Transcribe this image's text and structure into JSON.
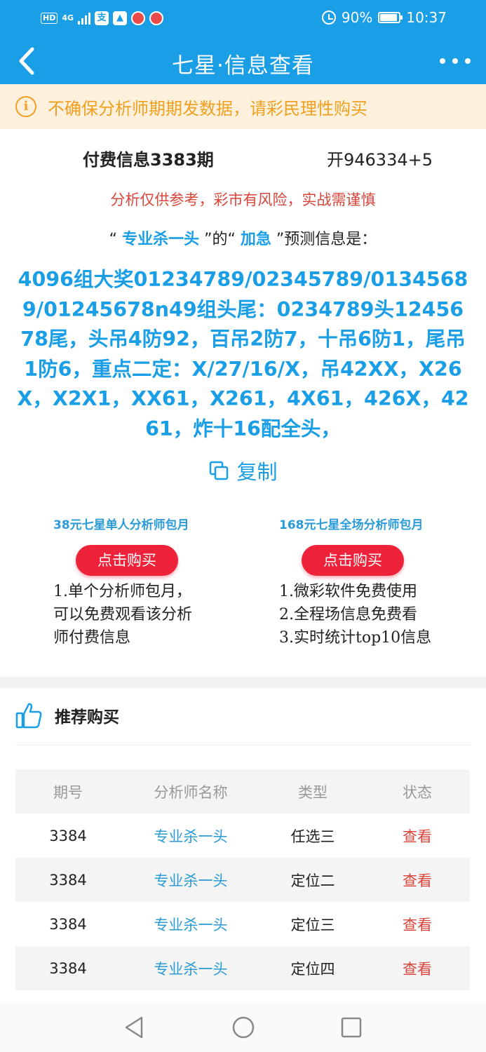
{
  "status_bar": {
    "hd": "HD",
    "network": "4G",
    "battery_percent": "90%",
    "battery_level": 0.9,
    "time": "10:37"
  },
  "nav": {
    "title": "七星·信息查看"
  },
  "notice": {
    "text": "不确保分析师期期发数据，请彩民理性购买"
  },
  "info": {
    "period": "付费信息3383期",
    "draw_result": "开946334+5",
    "risk": "分析仅供参考，彩市有风险，实战需谨慎",
    "predict_prefix": "“",
    "analyst_name": "专业杀一头",
    "predict_mid": "”的“",
    "category": "加急",
    "predict_suffix": "”预测信息是：",
    "content": "4096组大奖01234789/02345789/01345689/01245678n49组头尾：0234789头1245678尾，头吊4防92，百吊2防7，十吊6防1，尾吊1防6，重点二定：X/27/16/X，吊42XX，X26X，X2X1，XX61，X261，4X61，426X，4261，炸十16配全头，",
    "copy_label": "复制"
  },
  "packages": [
    {
      "title": "38元七星单人分析师包月",
      "button": "点击购买",
      "desc": [
        "1.单个分析师包月，",
        "可以免费观看该分析",
        "师付费信息"
      ]
    },
    {
      "title": "168元七星全场分析师包月",
      "button": "点击购买",
      "desc": [
        "1.微彩软件免费使用",
        "2.全程场信息免费看",
        "3.实时统计top10信息"
      ]
    }
  ],
  "recommend": {
    "title": "推荐购买",
    "columns": [
      "期号",
      "分析师名称",
      "类型",
      "状态"
    ],
    "rows": [
      {
        "period": "3384",
        "analyst": "专业杀一头",
        "type": "任选三",
        "status": "查看"
      },
      {
        "period": "3384",
        "analyst": "专业杀一头",
        "type": "定位二",
        "status": "查看"
      },
      {
        "period": "3384",
        "analyst": "专业杀一头",
        "type": "定位三",
        "status": "查看"
      },
      {
        "period": "3384",
        "analyst": "专业杀一头",
        "type": "定位四",
        "status": "查看"
      }
    ]
  },
  "colors": {
    "primary": "#1a9ee6",
    "notice": "#f0a020",
    "danger": "#ee2238",
    "risk": "#d9453a"
  }
}
